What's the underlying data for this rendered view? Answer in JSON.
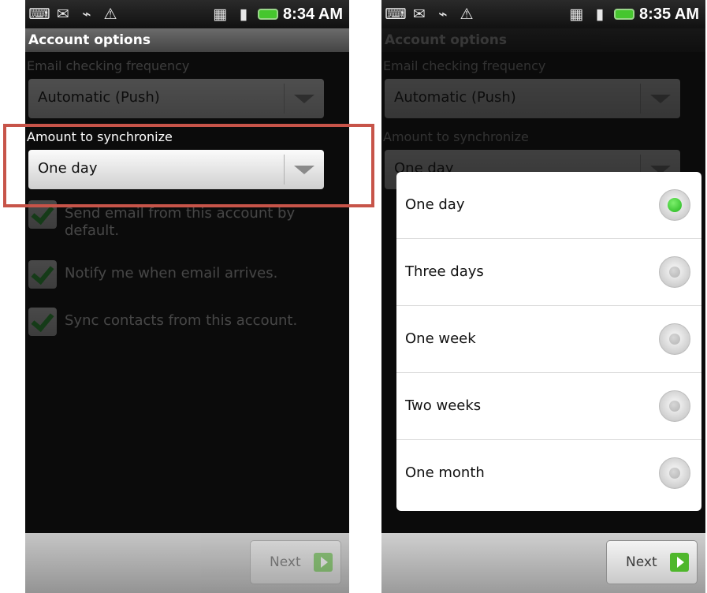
{
  "screens": [
    {
      "status_time": "8:34 AM",
      "title": "Account options",
      "email_freq_label": "Email checking frequency",
      "email_freq_value": "Automatic (Push)",
      "sync_label": "Amount to synchronize",
      "sync_value": "One day",
      "checks": [
        "Send email from this account by default.",
        "Notify me when email arrives.",
        "Sync contacts from this account."
      ],
      "next_label": "Next"
    },
    {
      "status_time": "8:35 AM",
      "title": "Account options",
      "email_freq_label": "Email checking frequency",
      "email_freq_value": "Automatic (Push)",
      "sync_label": "Amount to synchronize",
      "sync_value": "One day",
      "next_label": "Next",
      "dialog_options": [
        "One day",
        "Three days",
        "One week",
        "Two weeks",
        "One month"
      ],
      "selected_option": "One day"
    }
  ],
  "colors": {
    "accent_green": "#32b83c",
    "highlight_red": "#c75449"
  }
}
